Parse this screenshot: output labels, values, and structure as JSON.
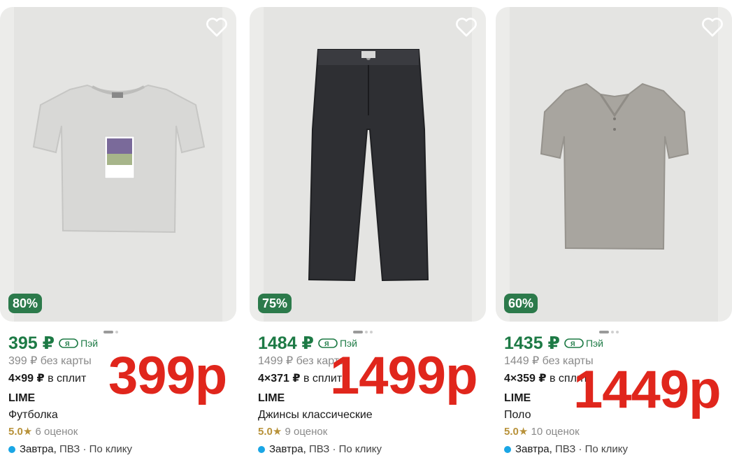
{
  "products": [
    {
      "discount": "80%",
      "price": "395 ₽",
      "pay_label": "Пэй",
      "old_price": "399 ₽ без карты",
      "split_amount": "4×99 ₽",
      "split_label": "в сплит",
      "brand": "LIME",
      "title": "Футболка",
      "rating": "5.0",
      "star": "★",
      "reviews": "6 оценок",
      "delivery_day": "Завтра,",
      "delivery_rest": "ПВЗ · По клику",
      "overlay": "399р"
    },
    {
      "discount": "75%",
      "price": "1484 ₽",
      "pay_label": "Пэй",
      "old_price": "1499 ₽ без карты",
      "split_amount": "4×371 ₽",
      "split_label": "в сплит",
      "brand": "LIME",
      "title": "Джинсы классические",
      "rating": "5.0",
      "star": "★",
      "reviews": "9 оценок",
      "delivery_day": "Завтра,",
      "delivery_rest": "ПВЗ · По клику",
      "overlay": "1499р"
    },
    {
      "discount": "60%",
      "price": "1435 ₽",
      "pay_label": "Пэй",
      "old_price": "1449 ₽ без карты",
      "split_amount": "4×359 ₽",
      "split_label": "в сплит",
      "brand": "LIME",
      "title": "Поло",
      "rating": "5.0",
      "star": "★",
      "reviews": "10 оценок",
      "delivery_day": "Завтра,",
      "delivery_rest": "ПВЗ · По клику",
      "overlay": "1449р"
    }
  ],
  "colors": {
    "price_green": "#1d7a45",
    "badge_green": "#2c7a4b",
    "overlay_red": "#e0261c",
    "delivery_dot": "#1aa6e5",
    "star_gold": "#b8923a"
  },
  "icons": [
    "heart-icon",
    "yandex-pay-icon",
    "tshirt-image",
    "jeans-image",
    "polo-image"
  ]
}
